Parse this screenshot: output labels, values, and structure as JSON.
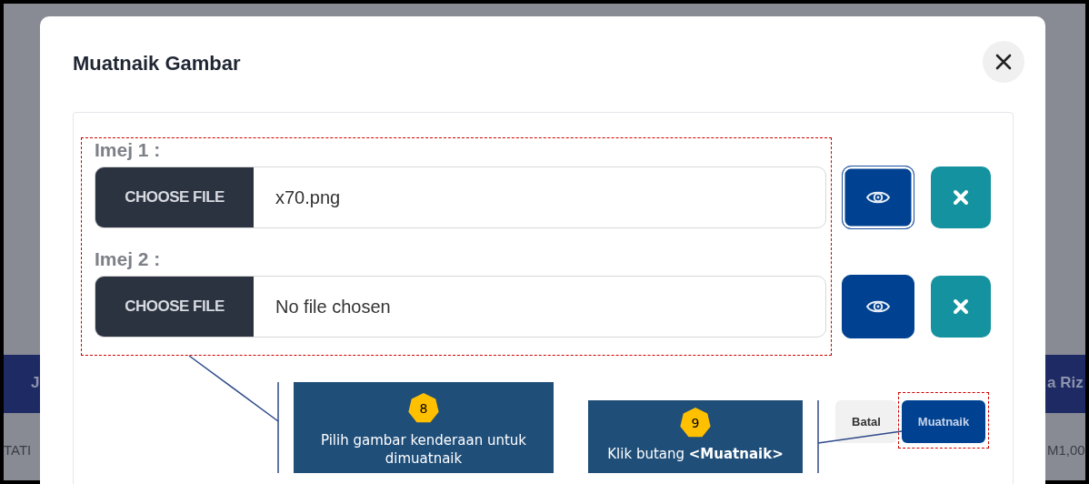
{
  "background": {
    "texts": [
      {
        "text": "J",
        "kind": "header-left"
      },
      {
        "text": "TATI",
        "kind": "cell-left"
      },
      {
        "text": "a Riz",
        "kind": "header-right"
      },
      {
        "text": "M1,00",
        "kind": "cell-right"
      }
    ]
  },
  "modal": {
    "title": "Muatnaik Gambar"
  },
  "uploads": [
    {
      "label": "Imej 1 :",
      "button": "CHOOSE FILE",
      "file": "x70.png",
      "focused": true
    },
    {
      "label": "Imej 2 :",
      "button": "CHOOSE FILE",
      "file": "No file chosen",
      "focused": false
    }
  ],
  "footer_buttons": [
    {
      "label": "Batal",
      "kind": "secondary"
    },
    {
      "label": "Muatnaik",
      "kind": "primary"
    }
  ],
  "callouts": [
    {
      "number": "8",
      "text": "Pilih gambar kenderaan untuk dimuatnaik",
      "kind": "upload"
    },
    {
      "number": "9",
      "text": "Klik butang **<Muatnaik>**",
      "kind": "submit"
    }
  ]
}
